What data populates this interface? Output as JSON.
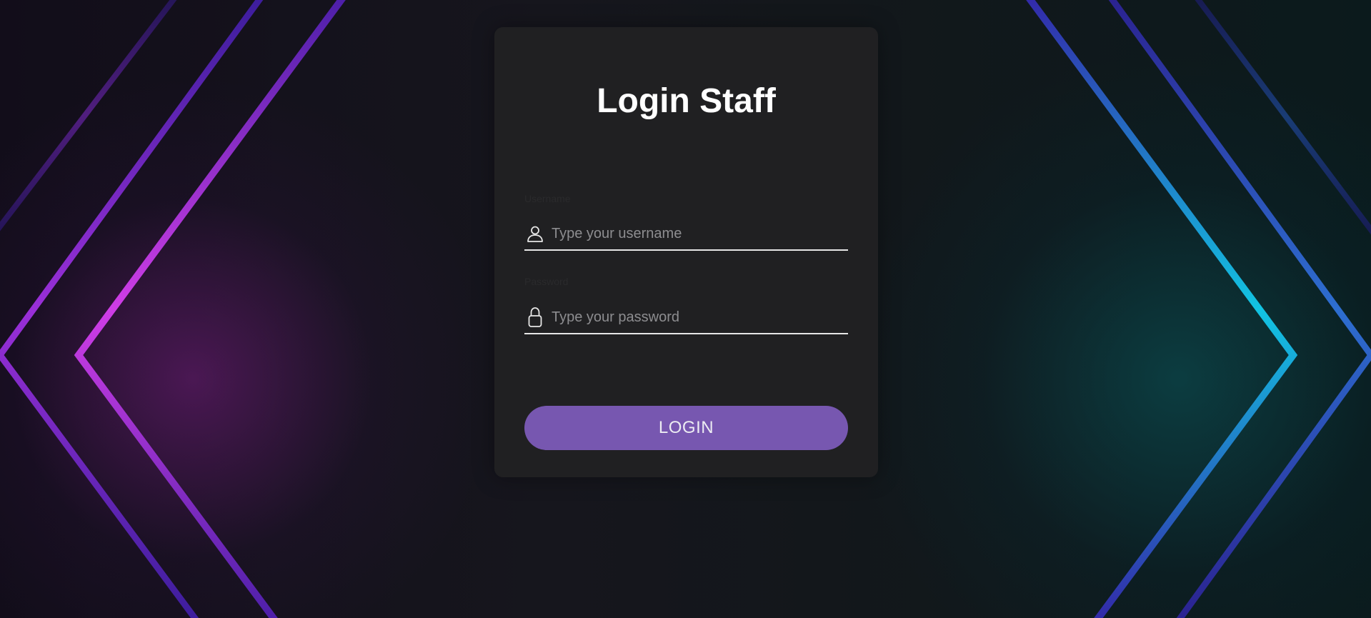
{
  "page": {
    "title": "Login Staff"
  },
  "form": {
    "username": {
      "label": "Username",
      "placeholder": "Type your username",
      "value": "",
      "icon": "user-icon"
    },
    "password": {
      "label": "Password",
      "placeholder": "Type your password",
      "value": "",
      "icon": "lock-icon"
    },
    "submit_label": "LOGIN"
  },
  "colors": {
    "card_background": "#202022",
    "button": "#7757b0",
    "accent_left": "#c238e0",
    "accent_right": "#16b8d8"
  }
}
